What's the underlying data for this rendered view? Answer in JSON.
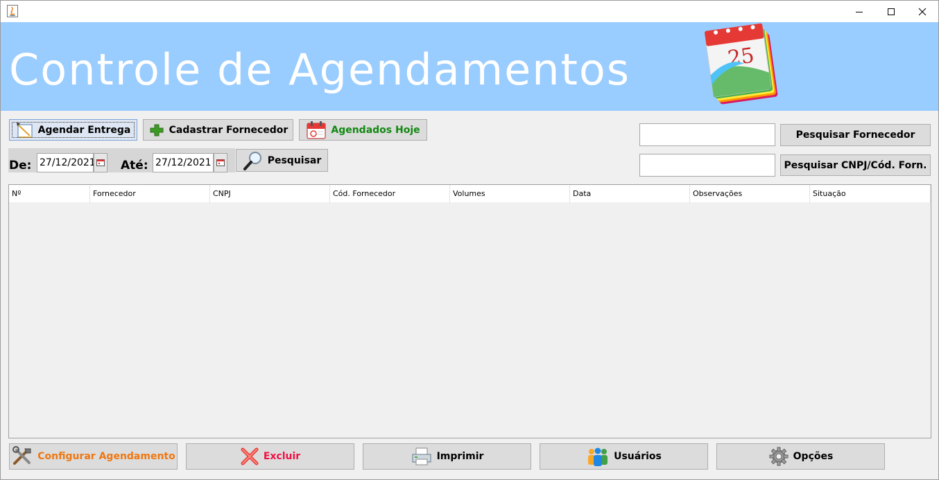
{
  "window": {
    "title": "",
    "controls": {
      "minimize": "minimize",
      "maximize": "maximize",
      "close": "close"
    }
  },
  "banner": {
    "title": "Controle de Agendamentos"
  },
  "toolbar": {
    "agendar_entrega": "Agendar Entrega",
    "cadastrar_fornecedor": "Cadastrar Fornecedor",
    "agendados_hoje": "Agendados Hoje"
  },
  "filter": {
    "de_label": "De:",
    "de_value": "27/12/2021",
    "ate_label": "Até:",
    "ate_value": "27/12/2021",
    "pesquisar": "Pesquisar"
  },
  "search": {
    "fornecedor_value": "",
    "fornecedor_button": "Pesquisar Fornecedor",
    "cnpj_value": "",
    "cnpj_button": "Pesquisar CNPJ/Cód. Forn."
  },
  "table": {
    "columns": [
      "Nº",
      "Fornecedor",
      "CNPJ",
      "Cód. Fornecedor",
      "Volumes",
      "Data",
      "Observações",
      "Situação"
    ],
    "rows": []
  },
  "footer": {
    "configurar": "Configurar Agendamento",
    "excluir": "Excluir",
    "imprimir": "Imprimir",
    "usuarios": "Usuários",
    "opcoes": "Opções"
  },
  "colors": {
    "banner_bg": "#99ccff",
    "agendados_text": "#118811",
    "configurar_text": "#ee7711",
    "excluir_text": "#ee1144"
  },
  "icons": {
    "agendar": "pencil-ruler-icon",
    "cadastrar": "green-plus-icon",
    "agendados": "red-calendar-icon",
    "pesquisar": "magnifier-icon",
    "configurar": "tools-icon",
    "excluir": "red-x-icon",
    "imprimir": "printer-icon",
    "usuarios": "users-icon",
    "opcoes": "gear-icon"
  }
}
